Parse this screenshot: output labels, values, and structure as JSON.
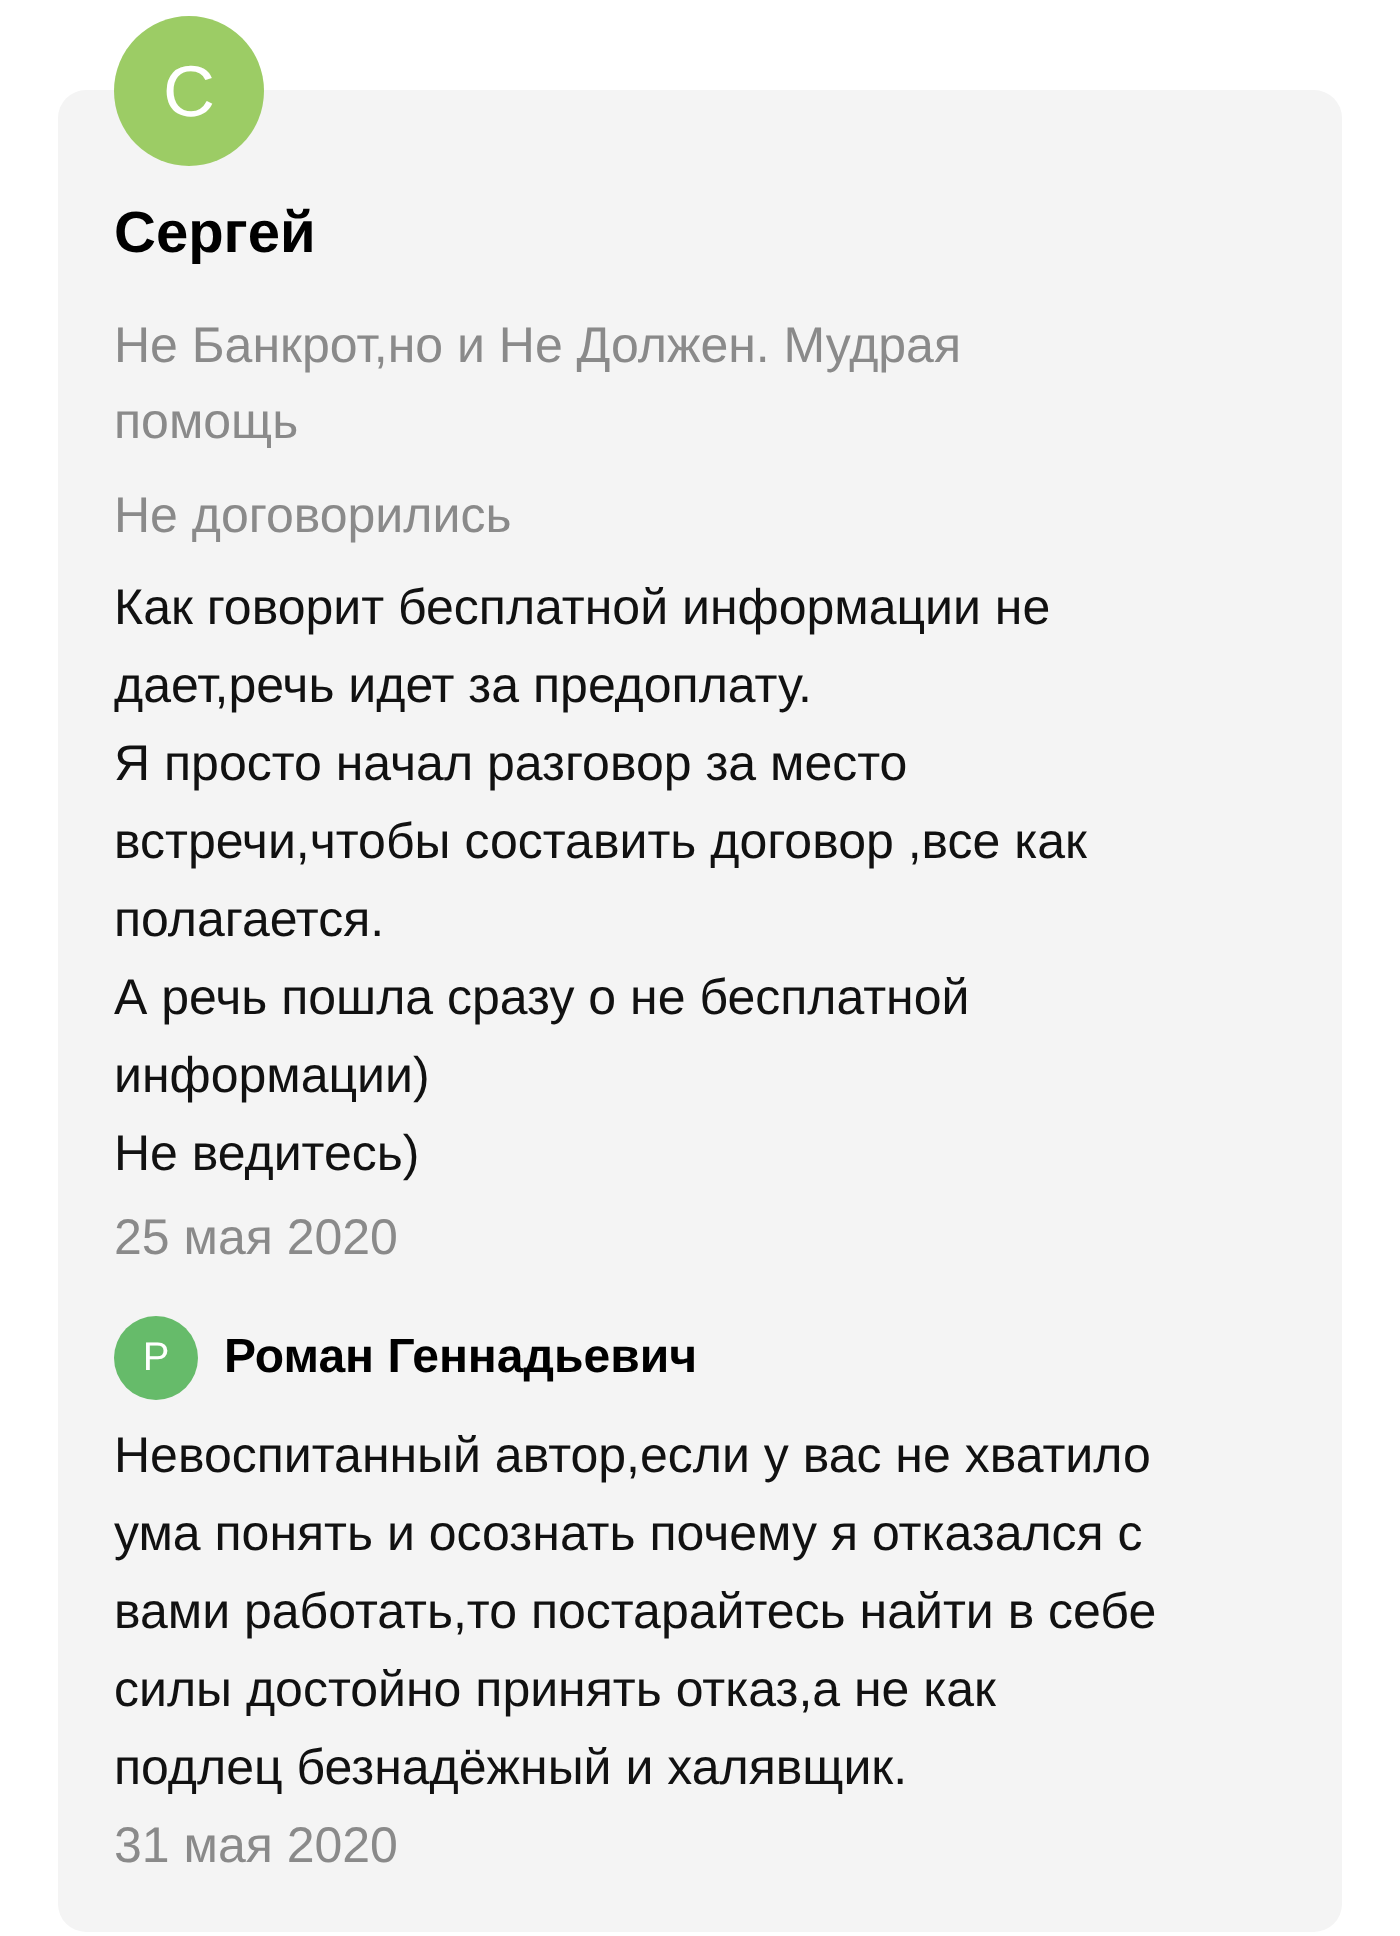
{
  "review": {
    "avatar_letter": "С",
    "author": "Сергей",
    "company": "Не Банкрот,но и Не Должен. Мудрая помощь",
    "status": "Не договорились",
    "text": "Как говорит бесплатной информации не дает,речь идет за предоплату.\nЯ просто начал разговор за место встречи,чтобы составить договор ,все как полагается.\nА речь пошла сразу о не бесплатной информации)\nНе ведитесь)",
    "date": "25 мая 2020",
    "reply": {
      "avatar_letter": "Р",
      "author": "Роман Геннадьевич",
      "text": "Невоспитанный автор,если у вас не хватило ума понять и осознать почему я отказался с вами работать,то постарайтесь найти в себе силы достойно принять отказ,а не как подлец безнадёжный и халявщик.",
      "date": "31 мая 2020"
    }
  }
}
